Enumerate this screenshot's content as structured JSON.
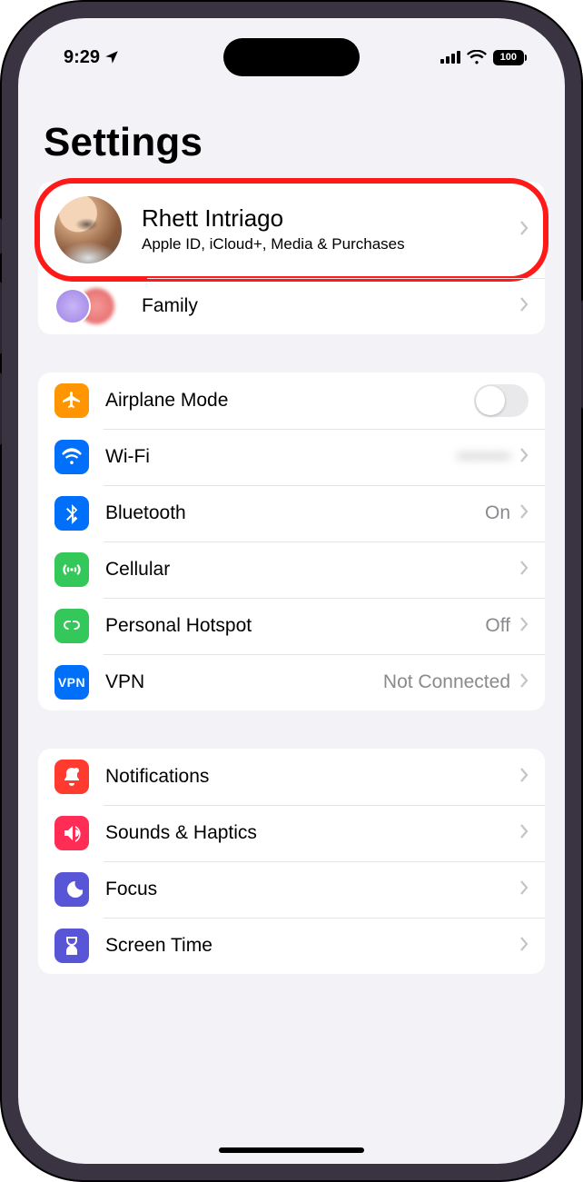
{
  "status": {
    "time": "9:29",
    "battery": "100"
  },
  "pageTitle": "Settings",
  "profile": {
    "name": "Rhett Intriago",
    "subtitle": "Apple ID, iCloud+, Media & Purchases"
  },
  "family": {
    "label": "Family"
  },
  "network": {
    "airplane": "Airplane Mode",
    "wifi": {
      "label": "Wi-Fi",
      "value": "••••••••"
    },
    "bluetooth": {
      "label": "Bluetooth",
      "value": "On"
    },
    "cellular": {
      "label": "Cellular"
    },
    "hotspot": {
      "label": "Personal Hotspot",
      "value": "Off"
    },
    "vpn": {
      "label": "VPN",
      "value": "Not Connected"
    }
  },
  "system": {
    "notifications": "Notifications",
    "sounds": "Sounds & Haptics",
    "focus": "Focus",
    "screentime": "Screen Time"
  },
  "colors": {
    "airplane": "#ff9500",
    "wifi": "#006ff9",
    "bluetooth": "#006ff9",
    "cellular": "#34c759",
    "hotspot": "#34c759",
    "vpn": "#006ff9",
    "notifications": "#ff3b30",
    "sounds": "#ff2d55",
    "focus": "#5856d6",
    "screentime": "#5856d6"
  }
}
